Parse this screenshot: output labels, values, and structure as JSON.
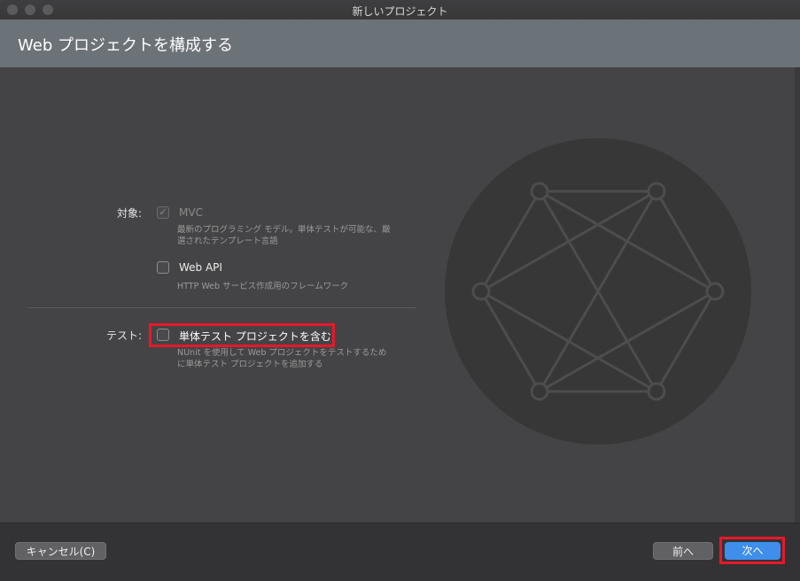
{
  "window": {
    "title": "新しいプロジェクト"
  },
  "header": {
    "title": "Web プロジェクトを構成する"
  },
  "target": {
    "label": "対象:",
    "options": [
      {
        "name": "MVC",
        "checked": true,
        "disabled": true,
        "description_lines": [
          "最新のプログラミング モデル。単体テストが可能な、厳",
          "選されたテンプレート言語"
        ]
      },
      {
        "name": "Web API",
        "checked": false,
        "disabled": false,
        "description_lines": [
          "HTTP Web サービス作成用のフレームワーク"
        ]
      }
    ]
  },
  "test": {
    "label": "テスト:",
    "option": {
      "name": "単体テスト プロジェクトを含む",
      "checked": false,
      "description_lines": [
        "NUnit を使用して Web プロジェクトをテストするため",
        "に単体テスト プロジェクトを追加する"
      ]
    }
  },
  "footer": {
    "cancel_label": "キャンセル(C)",
    "back_label": "前へ",
    "next_label": "次へ"
  },
  "colors": {
    "header_bg": "#6b7278",
    "accent": "#3e8eea",
    "highlight": "#e8182a"
  },
  "icons": {
    "check": "check-icon",
    "illustration": "network-graph-icon"
  }
}
